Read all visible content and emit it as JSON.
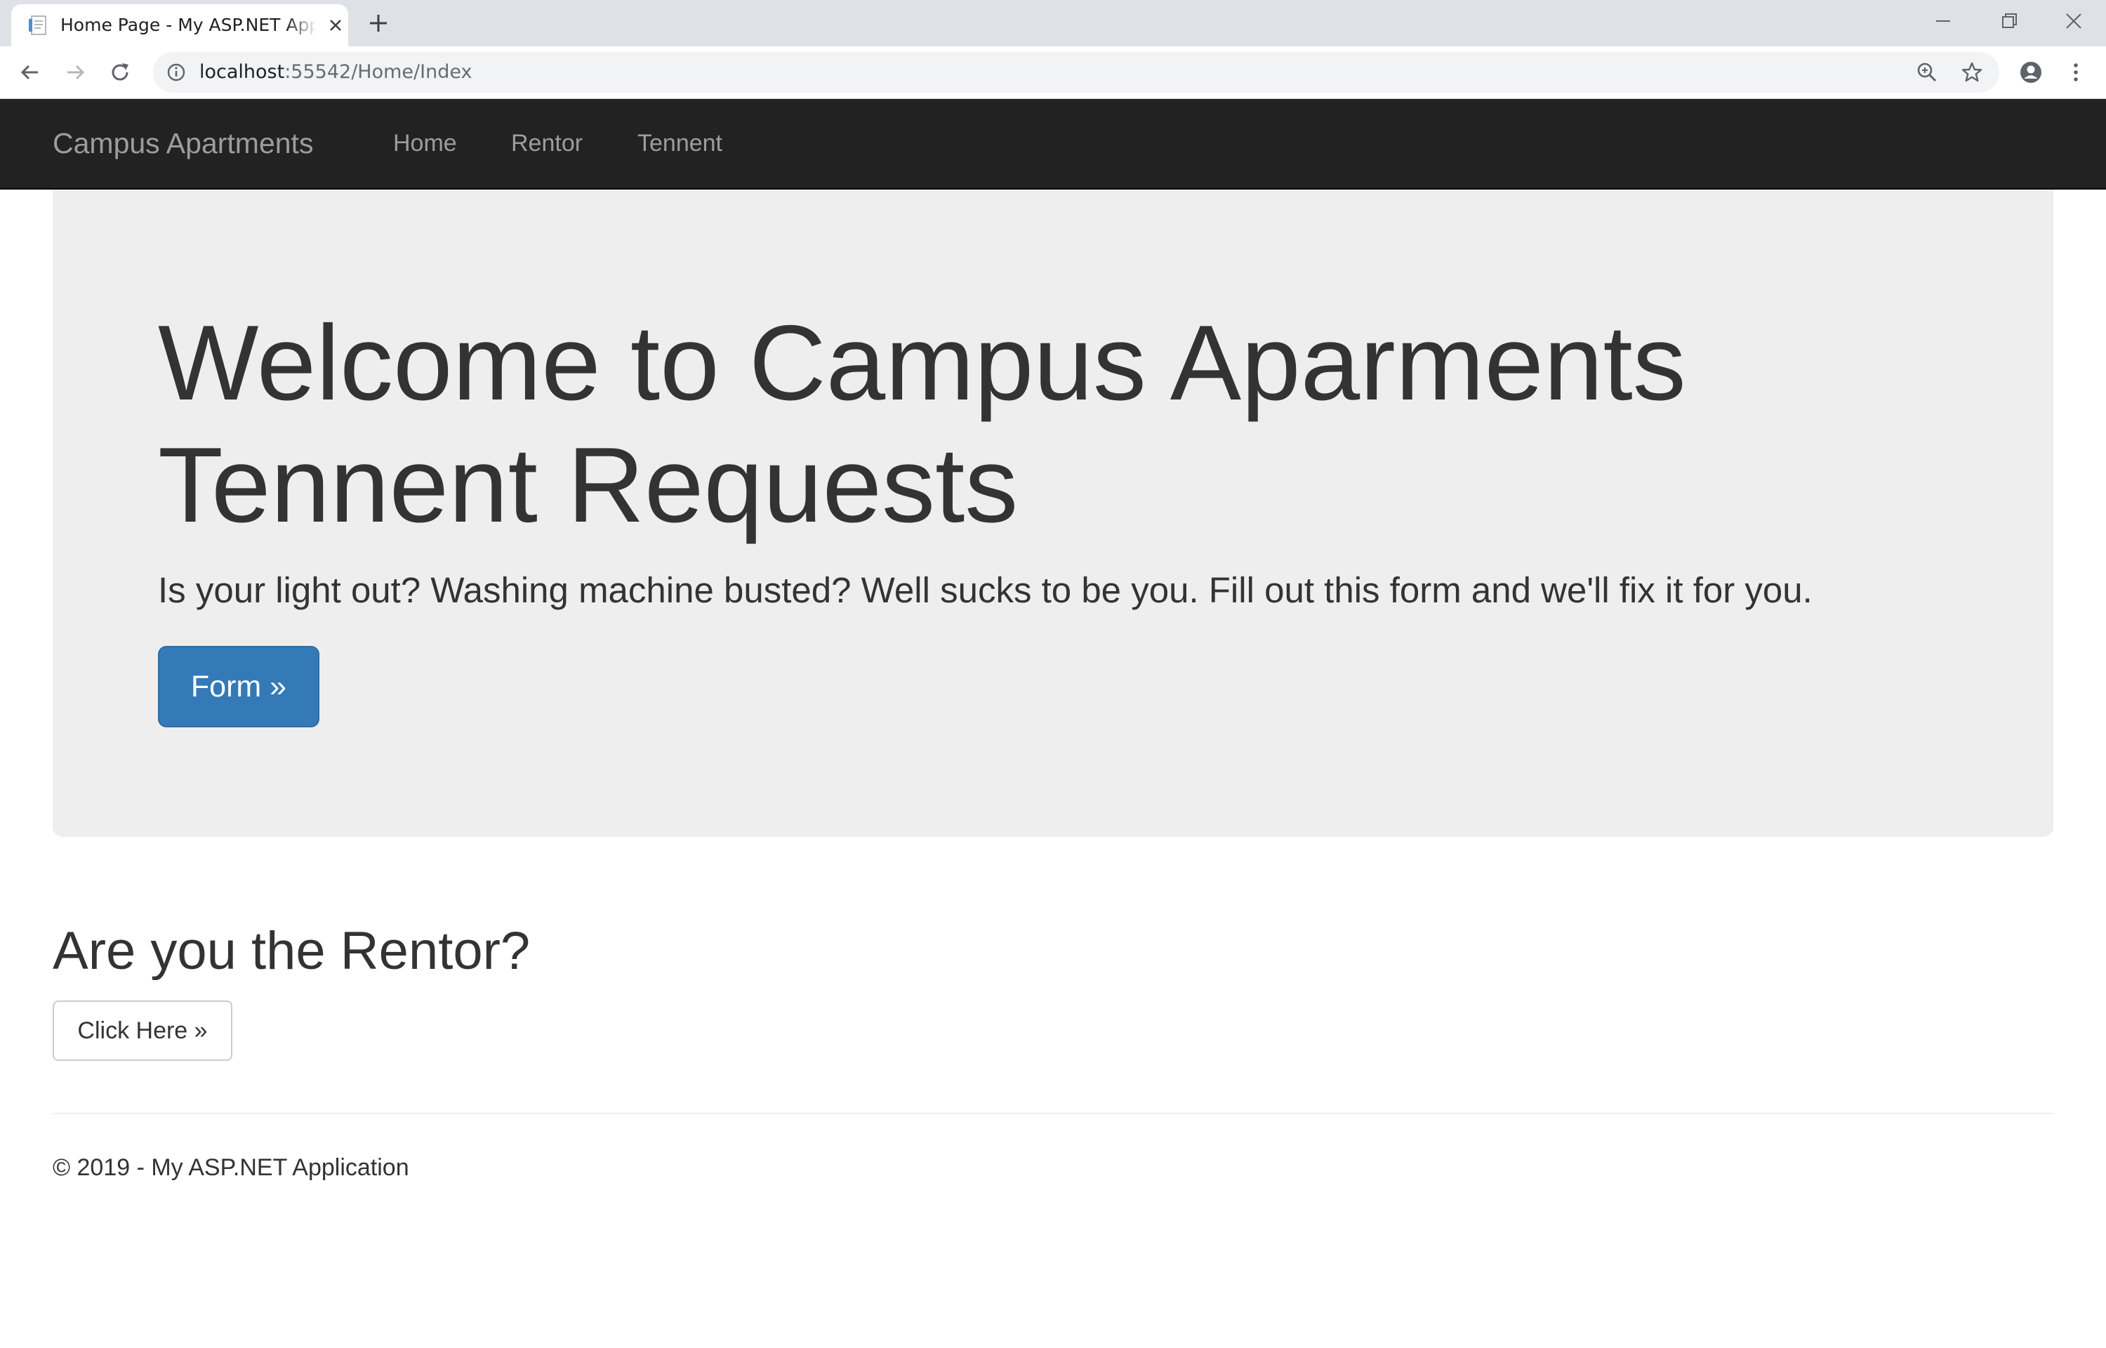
{
  "browser": {
    "tab_title": "Home Page - My ASP.NET Application",
    "url_host": "localhost",
    "url_rest": ":55542/Home/Index"
  },
  "navbar": {
    "brand": "Campus Apartments",
    "links": [
      "Home",
      "Rentor",
      "Tennent"
    ]
  },
  "jumbotron": {
    "title": "Welcome to Campus Aparments Tennent Requests",
    "lead": "Is your light out? Washing machine busted? Well sucks to be you. Fill out this form and we'll fix it for you.",
    "button": "Form »"
  },
  "rentor": {
    "heading": "Are you the Rentor?",
    "button": "Click Here »"
  },
  "footer": {
    "text": "© 2019 - My ASP.NET Application"
  }
}
